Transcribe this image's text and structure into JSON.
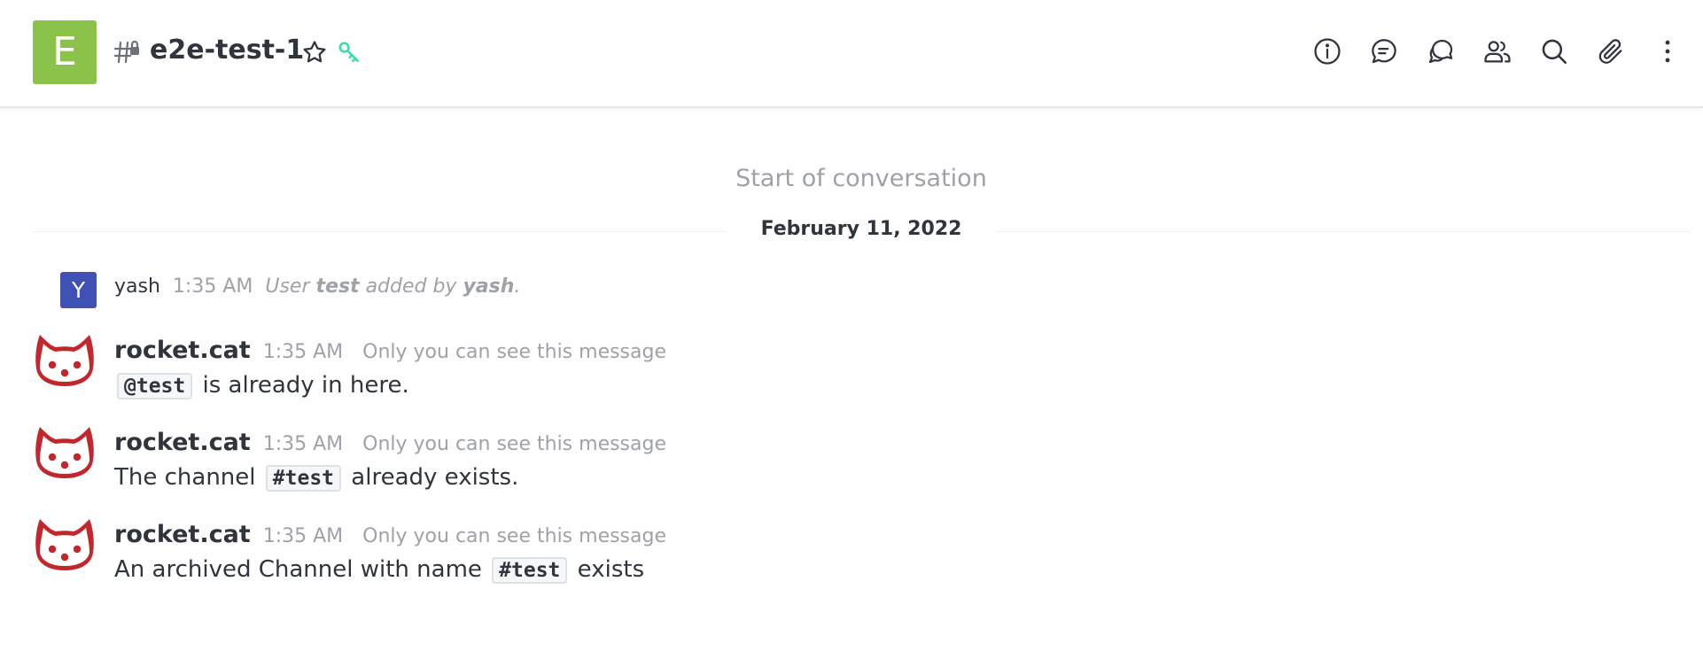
{
  "header": {
    "room_avatar_letter": "E",
    "room_avatar_color": "#8bc34a",
    "room_icon": "private-channel-lock-icon",
    "room_name": "e2e-test-1",
    "favorite_icon": "star-icon",
    "encryption_icon": "key-icon",
    "encryption_color": "#2de0a5",
    "toolbar": [
      {
        "name": "room-info",
        "icon": "info-icon"
      },
      {
        "name": "threads",
        "icon": "threads-icon"
      },
      {
        "name": "discussions",
        "icon": "discussion-icon"
      },
      {
        "name": "members",
        "icon": "members-icon"
      },
      {
        "name": "search-messages",
        "icon": "search-icon"
      },
      {
        "name": "files",
        "icon": "clip-icon"
      },
      {
        "name": "kebab-menu",
        "icon": "kebab-icon"
      }
    ]
  },
  "conversation": {
    "start_label": "Start of conversation",
    "date_divider": "February 11, 2022"
  },
  "system_message": {
    "avatar_letter": "Y",
    "avatar_color": "#3f51b5",
    "username": "yash",
    "time": "1:35 AM",
    "text_prefix": "User",
    "target_user": "test",
    "text_middle": "added by",
    "actor": "yash",
    "text_suffix": "."
  },
  "messages": [
    {
      "username": "rocket.cat",
      "time": "1:35 AM",
      "private_label": "Only you can see this message",
      "pre": "",
      "code": "@test",
      "post": " is already in here."
    },
    {
      "username": "rocket.cat",
      "time": "1:35 AM",
      "private_label": "Only you can see this message",
      "pre": "The channel ",
      "code": "#test",
      "post": " already exists."
    },
    {
      "username": "rocket.cat",
      "time": "1:35 AM",
      "private_label": "Only you can see this message",
      "pre": "An archived Channel with name ",
      "code": "#test",
      "post": " exists"
    }
  ]
}
